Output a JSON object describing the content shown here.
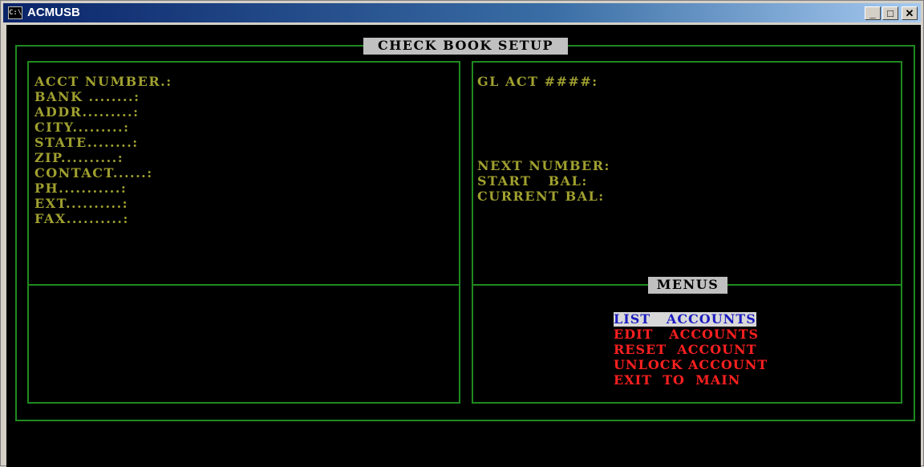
{
  "window": {
    "title": "ACMUSB",
    "icon_label": "C:\\",
    "minimize_label": "_",
    "maximize_label": "□",
    "close_label": "✕"
  },
  "screen": {
    "header": "CHECK BOOK SETUP",
    "left_fields": [
      "ACCT NUMBER.:",
      "BANK ........:",
      "ADDR.........:",
      "CITY.........:",
      "STATE........:",
      "ZIP..........:",
      "CONTACT......:",
      "PH...........:",
      "EXT..........:",
      "FAX..........:"
    ],
    "right_fields": {
      "gl_act": "GL ACT ####:",
      "next_number": "NEXT NUMBER:",
      "start_bal": "START   BAL:",
      "current_bal": "CURRENT BAL:"
    },
    "menus_header": "MENUS",
    "menu_items": [
      "LIST   ACCOUNTS",
      "EDIT   ACCOUNTS",
      "RESET  ACCOUNT",
      "UNLOCK ACCOUNT",
      "EXIT  TO  MAIN"
    ]
  }
}
